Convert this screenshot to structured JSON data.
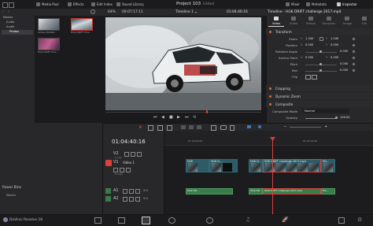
{
  "topbar": {
    "media_pool": "Media Pool",
    "effects": "Effects",
    "edit_index": "Edit Index",
    "sound_library": "Sound Library",
    "project_title": "Project 103",
    "edited": "Edited",
    "mixer": "Mixer",
    "metadata": "Metadata",
    "inspector": "Inspector"
  },
  "subbar": {
    "zoom": "64%",
    "src_timecode": "00:07:17:11",
    "timeline_name": "Timeline 1",
    "rec_timecode": "01:04:40:16",
    "clip_title": "Timeline - HGK DRIFT challenge 2017.mp4"
  },
  "media_pool": {
    "tree": [
      "Master",
      "Audio",
      "Audio",
      "Photos"
    ],
    "tree_selected": "Photos",
    "thumbs": [
      {
        "label": "Ashley Robber..."
      },
      {
        "label": "HGK DRIFT Cha..."
      },
      {
        "label": "HGK DRIFT Cha..."
      }
    ],
    "power_bins": "Power Bins",
    "power_bins_master": "Master"
  },
  "inspector": {
    "tabs": [
      "Video",
      "Audio",
      "Effects",
      "Transition",
      "Image",
      "File"
    ],
    "active_tab": "Video",
    "sections": {
      "transform": "Transform",
      "cropping": "Cropping",
      "dynamic_zoom": "Dynamic Zoom",
      "composite": "Composite"
    },
    "transform_rows": [
      {
        "label": "Zoom",
        "x_tag": "X",
        "x": "1.340",
        "y_tag": "Y",
        "y": "1.340"
      },
      {
        "label": "Position",
        "x_tag": "X",
        "x": "0.000",
        "y_tag": "Y",
        "y": "0.000"
      },
      {
        "label": "Rotation Angle",
        "x": "0.000"
      },
      {
        "label": "Anchor Point",
        "x_tag": "X",
        "x": "0.000",
        "y_tag": "Y",
        "y": "0.000"
      },
      {
        "label": "Pitch",
        "x": "0.000"
      },
      {
        "label": "Yaw",
        "x": "0.000"
      },
      {
        "label": "Flip",
        "x": ""
      }
    ],
    "composite_mode_label": "Composite Mode",
    "composite_mode_value": "Normal",
    "opacity_label": "Opacity",
    "opacity_value": "100.00"
  },
  "timeline": {
    "timecode": "01:04:40:16",
    "ruler": [
      "01:04:00:00",
      "01:05:00:00"
    ],
    "tracks": [
      {
        "name": "V2",
        "clips_label": "0 Clip"
      },
      {
        "name": "V1",
        "title": "Video 1",
        "clips_label": "8 Clips"
      },
      {
        "name": "A1",
        "vol": "2.0"
      },
      {
        "name": "A2",
        "vol": "2.0"
      }
    ],
    "video_clips": [
      {
        "label": "HGK"
      },
      {
        "label": "HGK D..."
      },
      {
        "label": "HGK D..."
      },
      {
        "label": "HGK DRIFT challenge 2017.mp4"
      },
      {
        "label": "HG..."
      }
    ],
    "audio_clips": [
      {
        "label": "HGK DR..."
      },
      {
        "label": "HGK DR..."
      },
      {
        "label": "HGK DRIFT challenge 2017.mp4"
      },
      {
        "label": "HG..."
      }
    ]
  },
  "app": {
    "name": "DaVinci Resolve 18"
  },
  "colors": {
    "accent_red": "#d9413a",
    "clip_teal": "#2d5b66",
    "audio_green": "#3a7b4a",
    "section_dot": "#e06b2d"
  }
}
